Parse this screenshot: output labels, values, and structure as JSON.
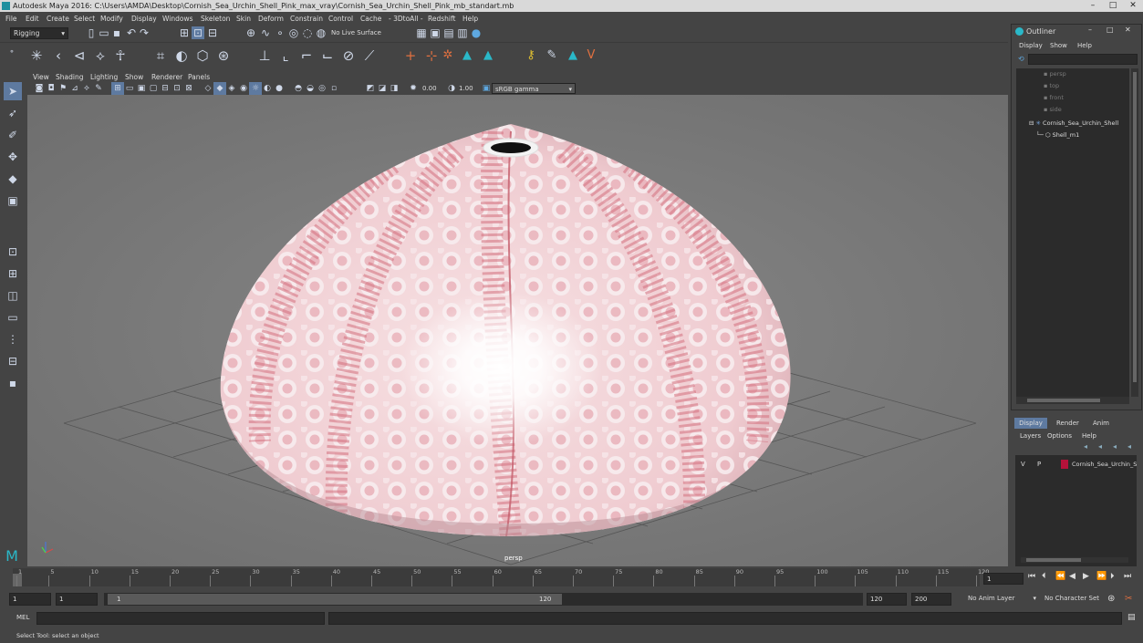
{
  "window": {
    "title": "Autodesk Maya 2016: C:\\Users\\AMDA\\Desktop\\Cornish_Sea_Urchin_Shell_Pink_max_vray\\Cornish_Sea_Urchin_Shell_Pink_mb_standart.mb"
  },
  "menus": [
    "File",
    "Edit",
    "Create",
    "Select",
    "Modify",
    "Display",
    "Windows",
    "Skeleton",
    "Skin",
    "Deform",
    "Constrain",
    "Control",
    "Cache",
    "- 3DtoAll -",
    "Redshift",
    "Help"
  ],
  "status_line": {
    "mode": "Rigging",
    "live_surface": "No Live Surface"
  },
  "viewport": {
    "menus": [
      "View",
      "Shading",
      "Lighting",
      "Show",
      "Renderer",
      "Panels"
    ],
    "exposure": "0.00",
    "gamma": "1.00",
    "color_space": "sRGB gamma",
    "camera_label": "persp"
  },
  "outliner": {
    "title": "Outliner",
    "menus": [
      "Display",
      "Show",
      "Help"
    ],
    "items": [
      {
        "label": "persp"
      },
      {
        "label": "top"
      },
      {
        "label": "front"
      },
      {
        "label": "side"
      },
      {
        "label": "Cornish_Sea_Urchin_Shell"
      },
      {
        "label": "Shell_m1"
      }
    ]
  },
  "channel_box": {
    "tabs": [
      "Display",
      "Render",
      "Anim"
    ],
    "menus": [
      "Layers",
      "Options",
      "Help"
    ],
    "layer": {
      "v": "V",
      "p": "P",
      "name": "Cornish_Sea_Urchin_S",
      "color": "#b5123a"
    }
  },
  "timeline": {
    "ticks": [
      "1",
      "5",
      "10",
      "15",
      "20",
      "25",
      "30",
      "35",
      "40",
      "45",
      "50",
      "55",
      "60",
      "65",
      "70",
      "75",
      "80",
      "85",
      "90",
      "95",
      "100",
      "105",
      "110",
      "115",
      "120"
    ],
    "current_frame": "1"
  },
  "range": {
    "start": "1",
    "anim_start": "1",
    "slider_start": "1",
    "slider_end": "120",
    "end": "120",
    "anim_end": "200",
    "anim_layer": "No Anim Layer",
    "character_set": "No Character Set"
  },
  "command_line": {
    "label": "MEL"
  },
  "help_line": {
    "text": "Select Tool: select an object"
  }
}
